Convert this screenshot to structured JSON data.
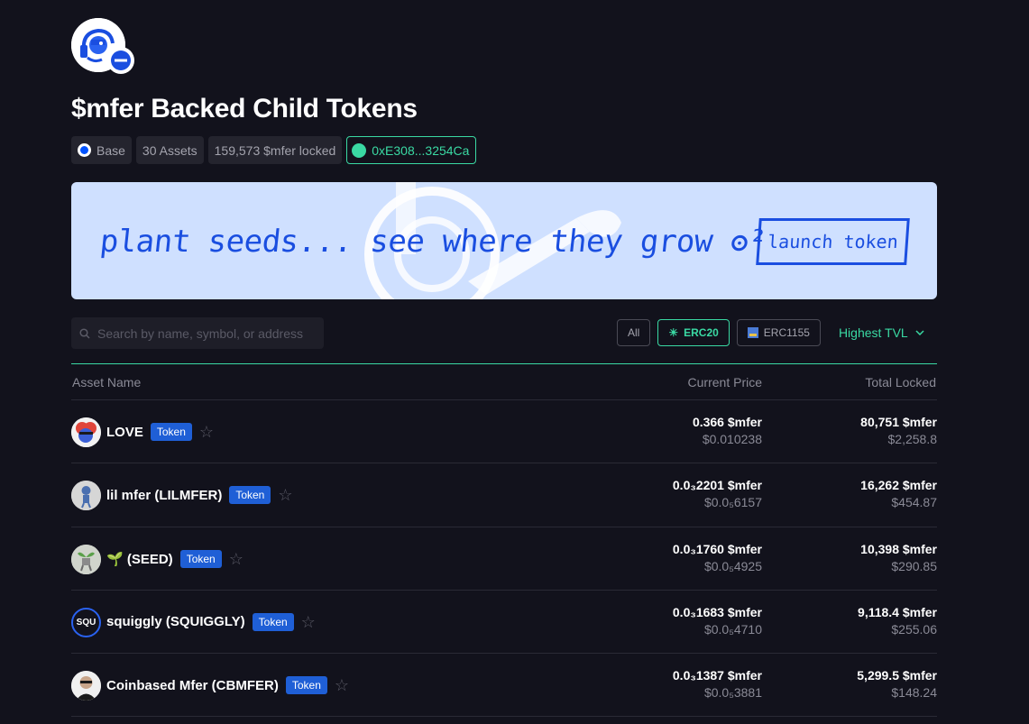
{
  "header": {
    "title": "$mfer Backed Child Tokens",
    "chips": {
      "network": "Base",
      "assets": "30 Assets",
      "locked": "159,573 $mfer locked",
      "address": "0xE308...3254Ca"
    }
  },
  "banner": {
    "text": "plant seeds... see where they grow ʘ²",
    "button_label": "launch token",
    "color": "#1a4ee0",
    "background": "#cfe0ff"
  },
  "search": {
    "placeholder": "Search by name, symbol, or address"
  },
  "filters": {
    "all": "All",
    "erc20": "ERC20",
    "erc1155": "ERC1155",
    "sort": "Highest TVL"
  },
  "table": {
    "headers": {
      "name": "Asset Name",
      "price": "Current Price",
      "locked": "Total Locked"
    },
    "rows": [
      {
        "name": "LOVE",
        "tag": "Token",
        "price_main": "0.366 $mfer",
        "price_usd": "$0.010238",
        "locked_main": "80,751 $mfer",
        "locked_usd": "$2,258.8"
      },
      {
        "name": "lil mfer (LILMFER)",
        "tag": "Token",
        "price_main": "0.0₃2201 $mfer",
        "price_usd": "$0.0₅6157",
        "locked_main": "16,262 $mfer",
        "locked_usd": "$454.87"
      },
      {
        "name": "🌱 (SEED)",
        "tag": "Token",
        "price_main": "0.0₃1760 $mfer",
        "price_usd": "$0.0₅4925",
        "locked_main": "10,398 $mfer",
        "locked_usd": "$290.85"
      },
      {
        "name": "squiggly (SQUIGGLY)",
        "tag": "Token",
        "avatar_text": "SQU",
        "price_main": "0.0₃1683 $mfer",
        "price_usd": "$0.0₅4710",
        "locked_main": "9,118.4 $mfer",
        "locked_usd": "$255.06"
      },
      {
        "name": "Coinbased Mfer (CBMFER)",
        "tag": "Token",
        "price_main": "0.0₃1387 $mfer",
        "price_usd": "$0.0₅3881",
        "locked_main": "5,299.5 $mfer",
        "locked_usd": "$148.24"
      }
    ]
  },
  "colors": {
    "accent": "#3ad9a3",
    "tag": "#1f5fd6",
    "background": "#12121c"
  }
}
